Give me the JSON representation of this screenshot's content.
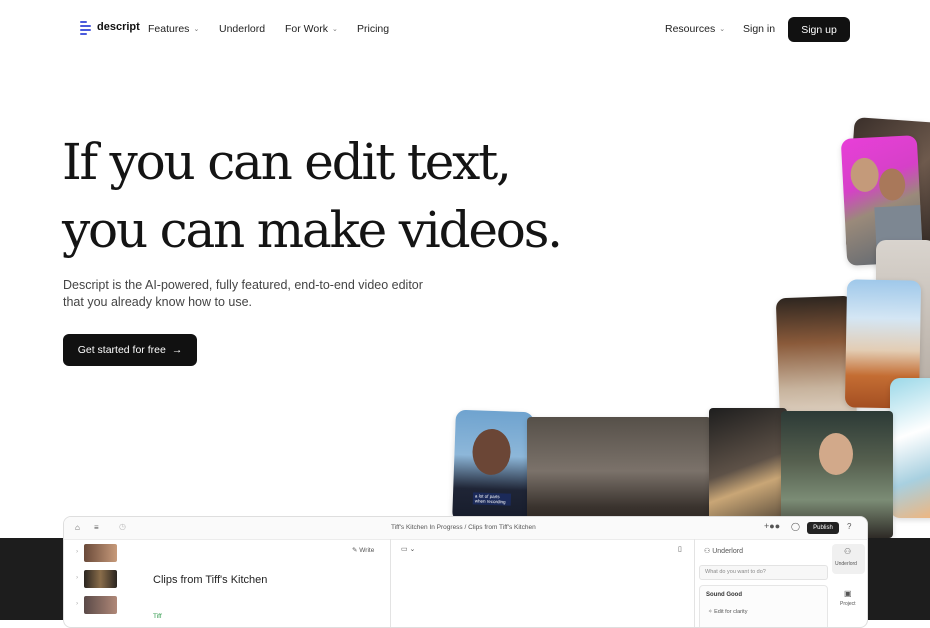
{
  "nav": {
    "logo": "descript",
    "links_left": [
      {
        "label": "Features",
        "dropdown": true
      },
      {
        "label": "Underlord",
        "dropdown": false
      },
      {
        "label": "For Work",
        "dropdown": true
      },
      {
        "label": "Pricing",
        "dropdown": false
      }
    ],
    "resources": "Resources",
    "signin": "Sign in",
    "signup": "Sign up"
  },
  "hero": {
    "line1": "If you can edit text,",
    "line2": "you can make videos.",
    "subtitle": "Descript is the AI-powered, fully featured, end-to-end video editor that you already know how to use.",
    "cta": "Get started for free",
    "cta_arrow": "→"
  },
  "overlay": {
    "caption": "a lot of parts when recording"
  },
  "app": {
    "breadcrumb": "Tiff's Kitchen In Progress  /  Clips from Tiff's Kitchen",
    "publish": "Publish",
    "write": "Write",
    "doc_title": "Clips from Tiff's Kitchen",
    "speaker": "Tiff",
    "underlord": "Underlord",
    "search_placeholder": "What do you want to do?",
    "card_title": "Sound Good",
    "card_item": "Edit for clarity",
    "side_underlord": "Underlord",
    "side_project": "Project"
  },
  "colors": {
    "accent": "#4a5bdc",
    "button": "#111111",
    "speaker": "#2f9a4b"
  }
}
